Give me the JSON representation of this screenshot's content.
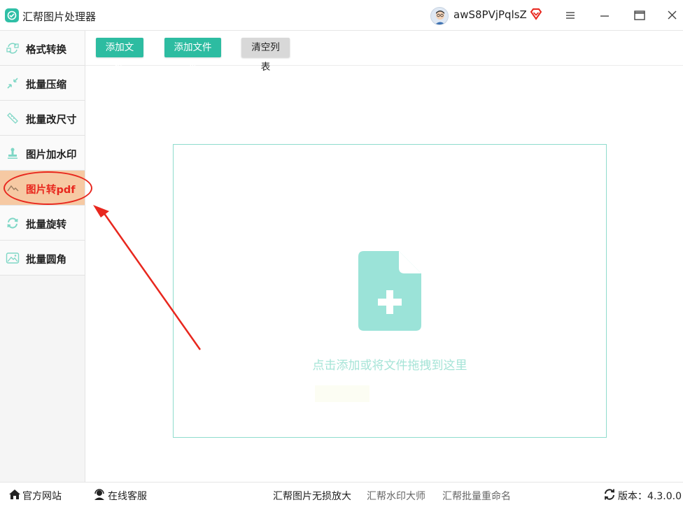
{
  "app": {
    "title": "汇帮图片处理器",
    "username": "awS8PVjPqlsZ"
  },
  "sidebar": {
    "items": [
      {
        "label": "格式转换",
        "icon": "format-convert-icon"
      },
      {
        "label": "批量压缩",
        "icon": "compress-icon"
      },
      {
        "label": "批量改尺寸",
        "icon": "resize-icon"
      },
      {
        "label": "图片加水印",
        "icon": "watermark-icon"
      },
      {
        "label": "图片转pdf",
        "icon": "image-to-pdf-icon",
        "active": true
      },
      {
        "label": "批量旋转",
        "icon": "rotate-icon"
      },
      {
        "label": "批量圆角",
        "icon": "rounded-corner-icon"
      }
    ]
  },
  "toolbar": {
    "add_file": "添加文件",
    "add_folder": "添加文件夹",
    "clear_list": "清空列表"
  },
  "dropzone": {
    "hint": "点击添加或将文件拖拽到这里"
  },
  "footer": {
    "website": "官方网站",
    "support": "在线客服",
    "links": [
      "汇帮图片无损放大",
      "汇帮水印大师",
      "汇帮批量重命名"
    ],
    "version": "版本：4.3.0.0"
  },
  "colors": {
    "accent": "#2dbca1",
    "active_item_bg": "#f6c9a3",
    "active_item_text": "#e8271e",
    "annotation_red": "#e8271e"
  }
}
